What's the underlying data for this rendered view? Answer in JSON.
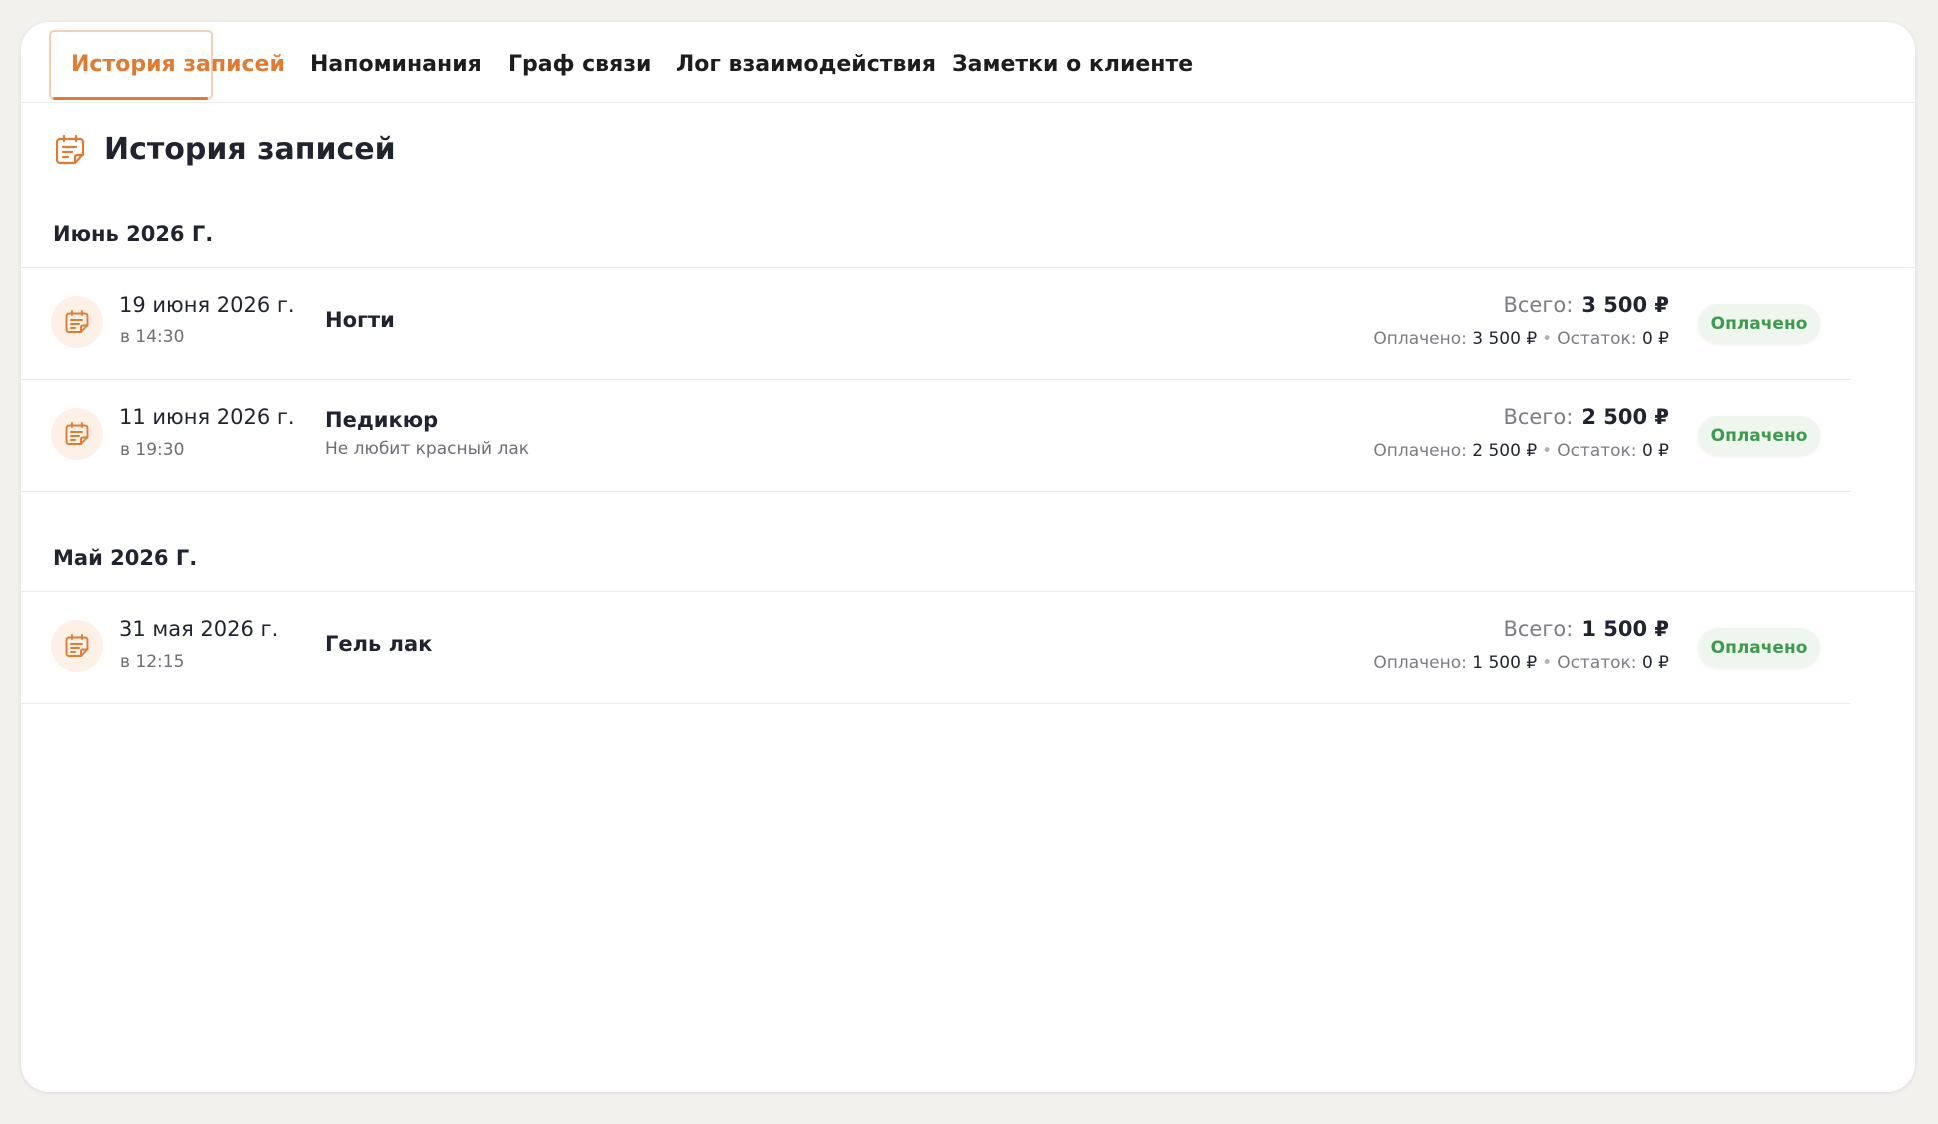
{
  "tabs": [
    {
      "label": "История записей",
      "active": true
    },
    {
      "label": "Напоминания",
      "active": false
    },
    {
      "label": "Граф связи",
      "active": false
    },
    {
      "label": "Лог взаимодействия",
      "active": false
    },
    {
      "label": "Заметки о клиенте",
      "active": false
    }
  ],
  "section": {
    "title": "История записей",
    "icon": "calendar-note-icon"
  },
  "groups": [
    {
      "month": "Июнь 2026 Г.",
      "records": [
        {
          "date": "19 июня 2026 г.",
          "time": "в 14:30",
          "service": "Ногти",
          "note": "",
          "total_label": "Всего:",
          "total": "3 500 ₽",
          "paid_label": "Оплачено:",
          "paid": "3 500 ₽",
          "rest_label": "Остаток:",
          "rest": "0 ₽",
          "status": "Оплачено"
        },
        {
          "date": "11 июня 2026 г.",
          "time": "в 19:30",
          "service": "Педикюр",
          "note": "Не любит красный лак",
          "total_label": "Всего:",
          "total": "2 500 ₽",
          "paid_label": "Оплачено:",
          "paid": "2 500 ₽",
          "rest_label": "Остаток:",
          "rest": "0 ₽",
          "status": "Оплачено"
        }
      ]
    },
    {
      "month": "Май 2026 Г.",
      "records": [
        {
          "date": "31 мая 2026 г.",
          "time": "в 12:15",
          "service": "Гель лак",
          "note": "",
          "total_label": "Всего:",
          "total": "1 500 ₽",
          "paid_label": "Оплачено:",
          "paid": "1 500 ₽",
          "rest_label": "Остаток:",
          "rest": "0 ₽",
          "status": "Оплачено"
        }
      ]
    }
  ],
  "colors": {
    "accent": "#e07b34",
    "status_paid_text": "#3d9a4f",
    "status_paid_bg": "#eef6ee"
  }
}
